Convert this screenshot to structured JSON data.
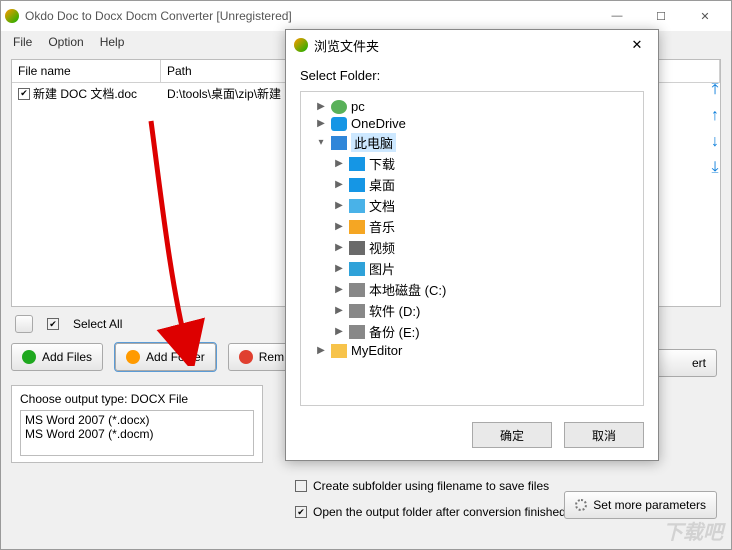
{
  "window": {
    "title": "Okdo Doc to Docx Docm Converter [Unregistered]"
  },
  "menu": {
    "file": "File",
    "option": "Option",
    "help": "Help"
  },
  "table": {
    "headers": {
      "filename": "File name",
      "path": "Path"
    },
    "rows": [
      {
        "filename": "新建 DOC 文档.doc",
        "path": "D:\\tools\\桌面\\zip\\新建"
      }
    ]
  },
  "select_all": "Select All",
  "buttons": {
    "add_files": "Add Files",
    "add_folder": "Add Folder",
    "remove": "Rem",
    "convert_suffix": "ert",
    "set_more": "Set more parameters"
  },
  "output": {
    "label": "Choose output type:  DOCX File",
    "opt1": "MS Word 2007 (*.docx)",
    "opt2": "MS Word 2007 (*.docm)"
  },
  "checks": {
    "subfolder": "Create subfolder using filename to save files",
    "openfolder": "Open the output folder after conversion finished"
  },
  "dialog": {
    "title": "浏览文件夹",
    "label": "Select Folder:",
    "ok": "确定",
    "cancel": "取消",
    "tree": {
      "pc": "pc",
      "onedrive": "OneDrive",
      "thispc": "此电脑",
      "downloads": "下载",
      "desktop": "桌面",
      "documents": "文档",
      "music": "音乐",
      "video": "视频",
      "pictures": "图片",
      "diskc": "本地磁盘 (C:)",
      "diskd": "软件 (D:)",
      "diske": "备份 (E:)",
      "myeditor": "MyEditor"
    }
  },
  "watermark": "下载吧"
}
